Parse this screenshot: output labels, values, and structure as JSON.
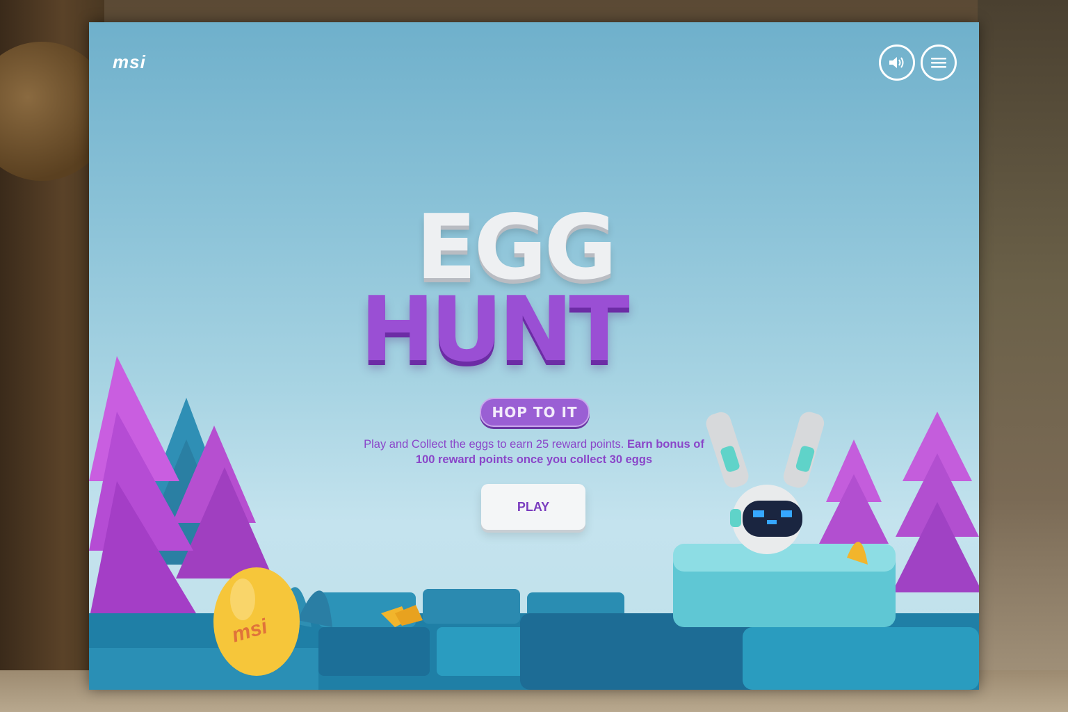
{
  "brand": {
    "logo_text": "msi"
  },
  "controls": {
    "sound_icon": "speaker-icon",
    "menu_icon": "hamburger-menu-icon"
  },
  "title": {
    "line1": "EGG",
    "line2": "HUNT"
  },
  "tagline": "HOP TO IT",
  "description": {
    "part1": "Play and Collect the eggs to earn 25 reward points.",
    "part2": "Earn bonus of 100 reward points once you collect 30 eggs"
  },
  "play_button": {
    "label": "PLAY"
  },
  "scene": {
    "egg_logo": "msi"
  },
  "colors": {
    "accent_purple": "#9a4fd4",
    "sky_top": "#6fb0cb",
    "sky_bottom": "#c4e3ee",
    "egg_yellow": "#f6c63a"
  }
}
